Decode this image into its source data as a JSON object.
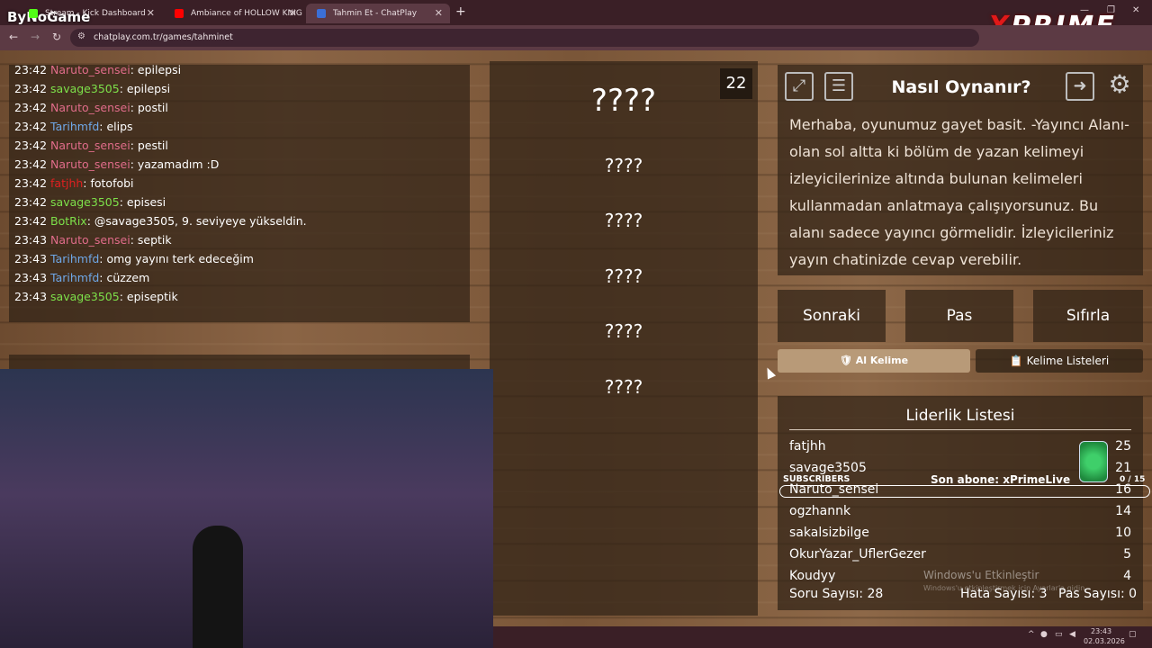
{
  "browser": {
    "tabs": [
      {
        "label": "Stream - Kick Dashboard",
        "favicon_color": "#53fc18"
      },
      {
        "label": "Ambiance of HOLLOW KNIG",
        "favicon_color": "#ff0000"
      },
      {
        "label": "Tahmin Et - ChatPlay",
        "favicon_color": "#3b6fd6"
      }
    ],
    "url": "chatplay.com.tr/games/tahminet",
    "brand_logo": "ByNoGame",
    "new_tab": "+"
  },
  "overlay": {
    "xprime_logo": {
      "x": "X",
      "rest": "PRIME"
    },
    "subs_label": "SUBSCRIBERS",
    "last_sub": "Son abone: xPrimeLive",
    "subs_count": "0 / 15",
    "windows_activate": "Windows'u Etkinleştir",
    "windows_activate_sub": "Windows'u etkinleştirmek için Ayarlar'a gidin."
  },
  "chat": {
    "messages": [
      {
        "time": "23:42",
        "user": "Naruto_sensei",
        "color": "#e06c8a",
        "text": ": epilepsi"
      },
      {
        "time": "23:42",
        "user": "savage3505",
        "color": "#7de04a",
        "text": ": epilepsi"
      },
      {
        "time": "23:42",
        "user": "Naruto_sensei",
        "color": "#e06c8a",
        "text": ": postil"
      },
      {
        "time": "23:42",
        "user": "Tarihmfd",
        "color": "#6fa8e8",
        "text": ": elips"
      },
      {
        "time": "23:42",
        "user": "Naruto_sensei",
        "color": "#e06c8a",
        "text": ": pestil"
      },
      {
        "time": "23:42",
        "user": "Naruto_sensei",
        "color": "#e06c8a",
        "text": ": yazamadım :D"
      },
      {
        "time": "23:42",
        "user": "fatjhh",
        "color": "#e02020",
        "text": ": fotofobi"
      },
      {
        "time": "23:42",
        "user": "savage3505",
        "color": "#7de04a",
        "text": ": episesi"
      },
      {
        "time": "23:42",
        "user": "BotRix",
        "color": "#7de04a",
        "text": ": @savage3505, 9. seviyeye yükseldin."
      },
      {
        "time": "23:43",
        "user": "Naruto_sensei",
        "color": "#e06c8a",
        "text": ": septik"
      },
      {
        "time": "23:43",
        "user": "Tarihmfd",
        "color": "#6fa8e8",
        "text": ": omg yayını terk edeceğim"
      },
      {
        "time": "23:43",
        "user": "Tarihmfd",
        "color": "#6fa8e8",
        "text": ": cüzzem"
      },
      {
        "time": "23:43",
        "user": "savage3505",
        "color": "#7de04a",
        "text": ": episeptik"
      }
    ]
  },
  "game": {
    "counter": "22",
    "main_word": "????",
    "forbidden_words": [
      "????",
      "????",
      "????",
      "????",
      "????"
    ]
  },
  "howto": {
    "title": "Nasıl Oynanır?",
    "text": "Merhaba, oyunumuz gayet basit. -Yayıncı Alanı- olan sol altta ki bölüm de yazan kelimeyi izleyicilerinize altında bulunan kelimeleri kullanmadan anlatmaya çalışıyorsunuz. Bu alanı sadece yayıncı görmelidir. İzleyicileriniz yayın chatinizde cevap verebilir."
  },
  "actions": {
    "next": "Sonraki",
    "pass": "Pas",
    "reset": "Sıfırla",
    "take_word": "Al Kelime",
    "take_word_icon": "🛡",
    "word_lists": "Kelime Listeleri",
    "word_lists_icon": "📋"
  },
  "leaderboard": {
    "title": "Liderlik Listesi",
    "rows": [
      {
        "name": "fatjhh",
        "score": "25"
      },
      {
        "name": "savage3505",
        "score": "21"
      },
      {
        "name": "Naruto_sensei",
        "score": "16"
      },
      {
        "name": "ogzhannk",
        "score": "14"
      },
      {
        "name": "sakalsizbilge",
        "score": "10"
      },
      {
        "name": "OkurYazar_UflerGezer",
        "score": "5"
      },
      {
        "name": "Koudyy",
        "score": "4"
      }
    ],
    "questions": "Soru Sayısı: 28",
    "errors": "Hata Sayısı: 3",
    "passes": "Pas Sayısı: 0"
  },
  "taskbar": {
    "time": "23:43",
    "date": "02.03.2026"
  }
}
